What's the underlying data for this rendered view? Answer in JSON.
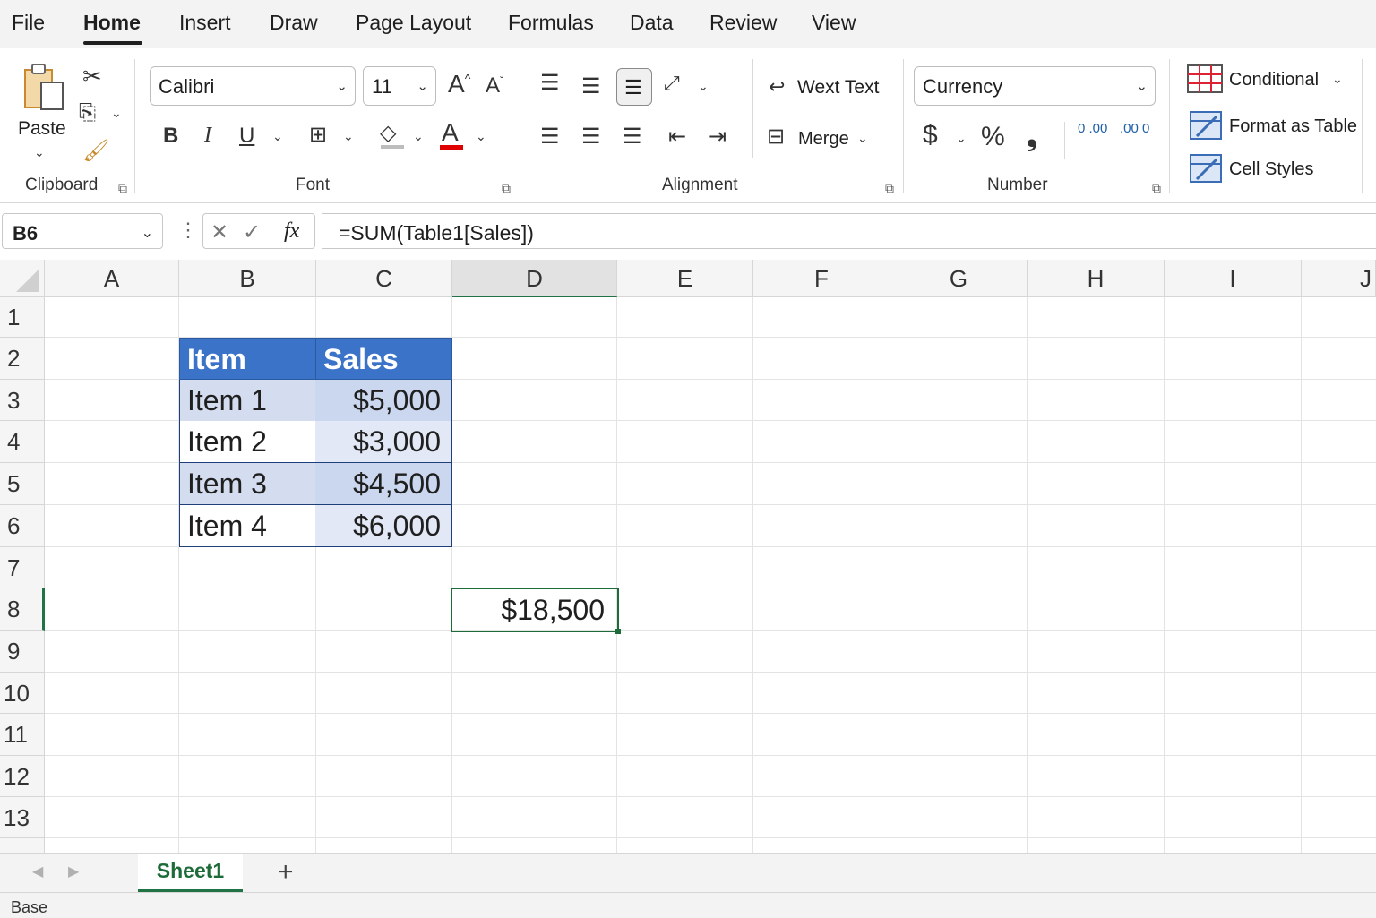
{
  "menu": {
    "tabs": [
      "File",
      "Home",
      "Insert",
      "Draw",
      "Page Layout",
      "Formulas",
      "Data",
      "Review",
      "View"
    ],
    "active": "Home"
  },
  "ribbon": {
    "clipboard": {
      "paste_label": "Paste",
      "group_label": "Clipboard"
    },
    "font": {
      "font_name": "Calibri",
      "font_size": "11",
      "bold": "B",
      "italic": "I",
      "underline": "U",
      "font_color_glyph": "A",
      "grow_glyph": "A",
      "shrink_glyph": "A",
      "group_label": "Font"
    },
    "alignment": {
      "wrap_label": "Wext Text",
      "merge_label": "Merge",
      "group_label": "Alignment"
    },
    "number": {
      "format": "Currency",
      "dollar": "$",
      "percent": "%",
      "comma": "❟",
      "inc_decimal": "0 .00",
      "dec_decimal": ".00 0",
      "group_label": "Number"
    },
    "styles": {
      "conditional_label": "Conditional",
      "format_table_label": "Format as Table",
      "cell_styles_label": "Cell Styles"
    }
  },
  "formula_bar": {
    "name_box": "B6",
    "fx": "fx",
    "formula": "=SUM(Table1[Sales])"
  },
  "grid": {
    "columns": [
      "A",
      "B",
      "C",
      "D",
      "E",
      "F",
      "G",
      "H",
      "I",
      "J"
    ],
    "rows": [
      "1",
      "2",
      "3",
      "4",
      "5",
      "6",
      "7",
      "8",
      "9",
      "10",
      "11",
      "12",
      "13"
    ],
    "selected_column": "D",
    "selected_row": "8"
  },
  "table": {
    "headers": [
      "Item",
      "Sales"
    ],
    "rows": [
      [
        "Item 1",
        "$5,000"
      ],
      [
        "Item 2",
        "$3,000"
      ],
      [
        "Item 3",
        "$4,500"
      ],
      [
        "Item 4",
        "$6,000"
      ]
    ]
  },
  "total_cell": "$18,500",
  "sheets": {
    "tabs": [
      "Sheet1"
    ],
    "add": "+"
  },
  "status": {
    "text": "Base"
  },
  "colors": {
    "accent": "#217346",
    "table_header": "#3b73c9",
    "band": "#d4dcef"
  }
}
